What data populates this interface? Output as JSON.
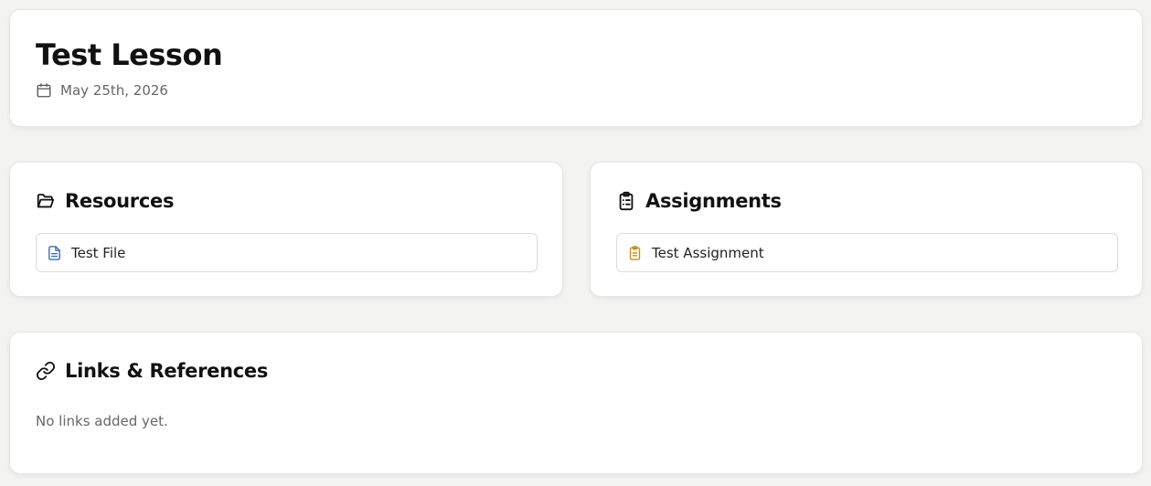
{
  "lesson": {
    "title": "Test Lesson",
    "date": "May 25th, 2026",
    "date_icon": "calendar-icon"
  },
  "resources": {
    "title": "Resources",
    "icon": "folder-open-icon",
    "items": [
      {
        "label": "Test File",
        "icon": "file-text-icon",
        "icon_color": "#3b6fb0"
      }
    ]
  },
  "assignments": {
    "title": "Assignments",
    "icon": "clipboard-list-icon",
    "items": [
      {
        "label": "Test Assignment",
        "icon": "clipboard-icon",
        "icon_color": "#c9901c"
      }
    ]
  },
  "links": {
    "title": "Links & References",
    "icon": "link-icon",
    "empty_text": "No links added yet."
  }
}
